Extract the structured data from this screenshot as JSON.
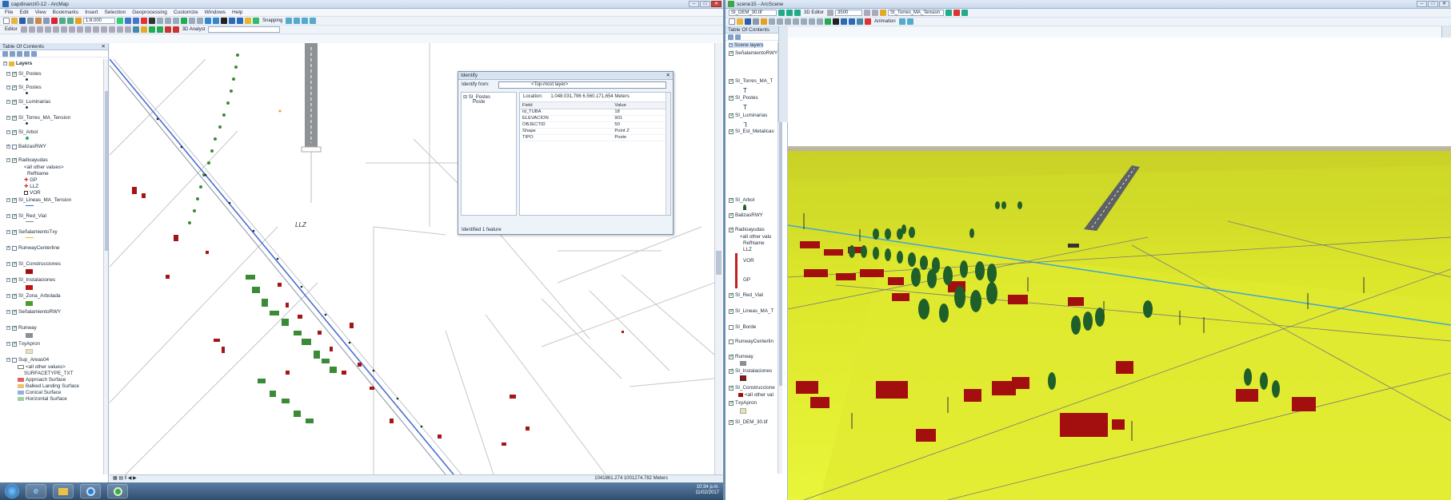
{
  "arcmap": {
    "title": "capdinanzi0-12 - ArcMap",
    "menu": [
      "File",
      "Edit",
      "View",
      "Bookmarks",
      "Insert",
      "Selection",
      "Geoprocessing",
      "Customize",
      "Windows",
      "Help"
    ],
    "scale": "1:8.000",
    "editor_label": "Editor",
    "analyst_label": "3D Analyst",
    "snapping_label": "Snapping",
    "toc_title": "Table Of Contents",
    "layers_root": "Layers",
    "layers": [
      {
        "name": "SI_Postes",
        "checked": true
      },
      {
        "name": "SI_Postes",
        "checked": true
      },
      {
        "name": "SI_Luminarias",
        "checked": true
      },
      {
        "name": "SI_Torres_MA_Tension",
        "checked": true
      },
      {
        "name": "SI_Arbol",
        "checked": true
      },
      {
        "name": "BalizasRWY",
        "checked": false
      },
      {
        "name": "Radioayudas",
        "checked": true
      },
      {
        "name": "SI_Lineas_MA_Tension",
        "checked": true
      },
      {
        "name": "SI_Red_Vial",
        "checked": true
      },
      {
        "name": "SeñalamientoTxy",
        "checked": true
      },
      {
        "name": "RunwayCenterline",
        "checked": false
      },
      {
        "name": "SI_Construcciones",
        "checked": true
      },
      {
        "name": "SI_Instalaciones",
        "checked": true
      },
      {
        "name": "SI_Zona_Arbolada",
        "checked": true
      },
      {
        "name": "SeñalamientoRWY",
        "checked": true
      },
      {
        "name": "Runway",
        "checked": true
      },
      {
        "name": "TxyApron",
        "checked": true
      },
      {
        "name": "Sup_Areas04",
        "checked": false
      }
    ],
    "radio_values": [
      "<all other values>",
      "RefName",
      "GP",
      "LLZ",
      "VOR"
    ],
    "surface_legend": {
      "header": "SURFACETYPE_TXT",
      "other": "<all other values>",
      "items": [
        {
          "label": "Approach Surface",
          "color": "#e06060"
        },
        {
          "label": "Balked Landing Surface",
          "color": "#f0c070"
        },
        {
          "label": "Conical Surface",
          "color": "#8fb0e0"
        },
        {
          "label": "Horizontal Surface",
          "color": "#9fd0a0"
        }
      ]
    },
    "map_label": "LLZ",
    "coords": "1041861.274 1001274.782 Meters"
  },
  "identify": {
    "title": "Identify",
    "from_label": "Identify from:",
    "from_value": "<Top-most layer>",
    "tree_layer": "SI_Postes",
    "tree_item": "Poste",
    "location_label": "Location:",
    "location_value": "1.048.031,796 6.560.171,654 Meters",
    "columns": [
      "Field",
      "Value"
    ],
    "rows": [
      {
        "field": "Id_TUBA",
        "value": "18"
      },
      {
        "field": "ELEVACION",
        "value": "901"
      },
      {
        "field": "OBJECTID",
        "value": "50"
      },
      {
        "field": "Shape",
        "value": "Point Z"
      },
      {
        "field": "TIPO",
        "value": "Poste"
      }
    ],
    "footer": "Identified 1 feature"
  },
  "arcscene": {
    "title": "scene15 - ArcScene",
    "layer_select": "SI_DEM_30.tif",
    "editor_label": "3D Editor",
    "scale": "3500",
    "layer_select2": "SI_Torres_MA_Tension",
    "animation_label": "Animation",
    "toc_title": "Table Of Contents",
    "root": "Scene layers",
    "layers": [
      {
        "name": "SeñalamientoRWY",
        "checked": true
      },
      {
        "name": "SI_Torres_MA_T",
        "checked": true
      },
      {
        "name": "SI_Postes",
        "checked": true
      },
      {
        "name": "SI_Luminarias",
        "checked": true
      },
      {
        "name": "SI_Est_Metalicas",
        "checked": true
      },
      {
        "name": "SI_Arbol",
        "checked": true
      },
      {
        "name": "BalizasRWY",
        "checked": true
      },
      {
        "name": "Radioayudas",
        "checked": true
      },
      {
        "name": "SI_Red_Vial",
        "checked": true
      },
      {
        "name": "SI_Lineas_MA_T",
        "checked": true
      },
      {
        "name": "SI_Borde",
        "checked": false
      },
      {
        "name": "RunwayCenterlin",
        "checked": false
      },
      {
        "name": "Runway",
        "checked": true
      },
      {
        "name": "SI_Instalaciones",
        "checked": true
      },
      {
        "name": "SI_Construccione",
        "checked": true
      },
      {
        "name": "TxyApron",
        "checked": true
      },
      {
        "name": "SI_DEM_30.tif",
        "checked": true
      }
    ],
    "radio_values": [
      "<all other valu",
      "RefName",
      "LLZ",
      "VOR",
      "GP"
    ],
    "construc_other": "<all other val"
  },
  "taskbar": {
    "time": "10:34 p.m.",
    "date": "11/02/2017"
  },
  "colors": {
    "building": "#a30f0f",
    "tree": "#1f5f2a",
    "terrain": "#e6f226",
    "powerline": "#3aa6d8"
  }
}
